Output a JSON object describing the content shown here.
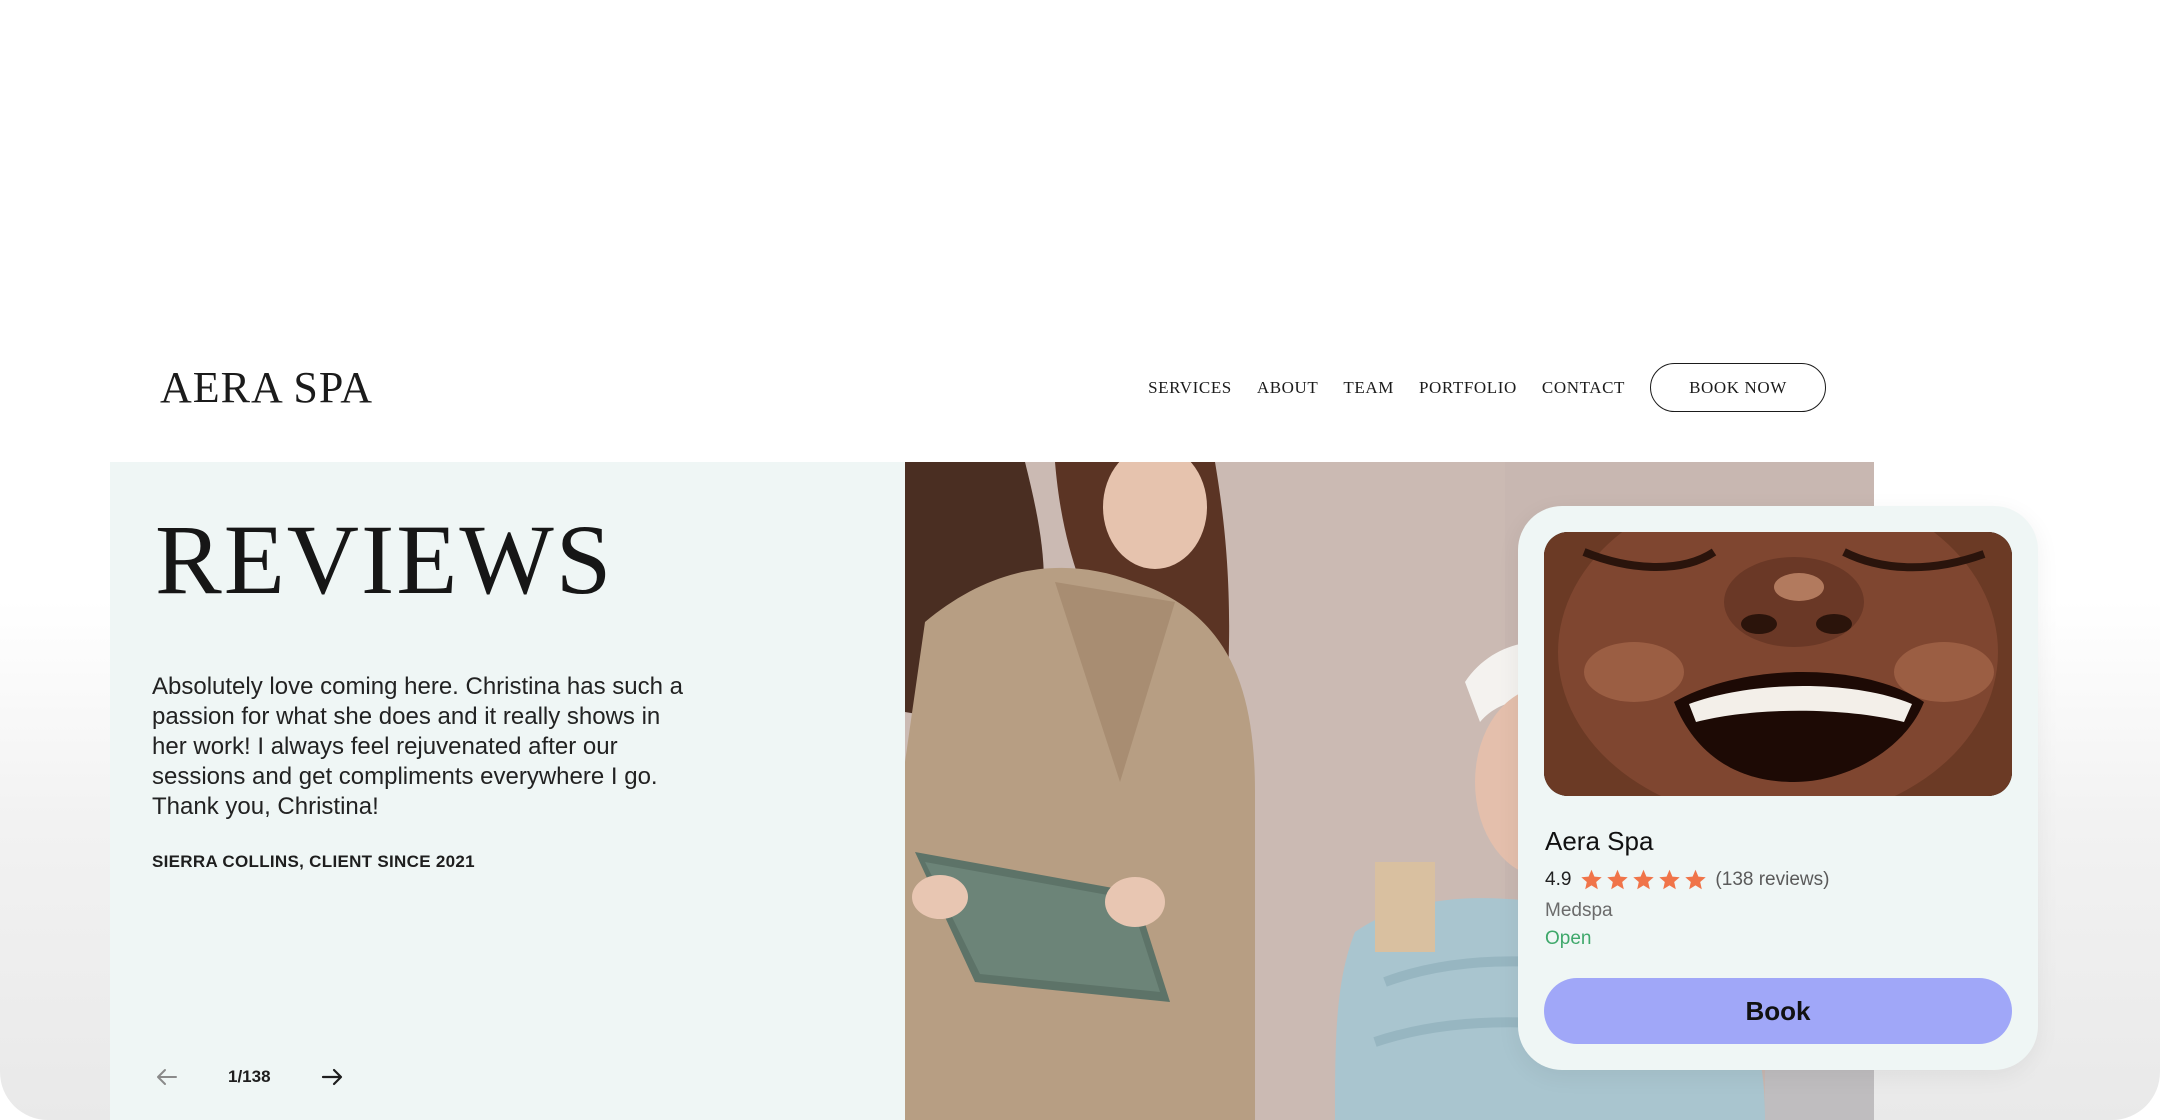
{
  "brand": {
    "logo": "AERA SPA"
  },
  "nav": {
    "items": [
      "SERVICES",
      "ABOUT",
      "TEAM",
      "PORTFOLIO",
      "CONTACT"
    ],
    "cta_label": "BOOK NOW"
  },
  "reviews": {
    "title": "REVIEWS",
    "quote": "Absolutely love coming here. Christina has such a passion for what she does and it really shows in her work! I always feel rejuvenated after our sessions and get compliments everywhere I go. Thank you, Christina!",
    "attribution": "SIERRA COLLINS, CLIENT SINCE 2021",
    "pager": {
      "current": 1,
      "total": 138,
      "label": "1/138"
    }
  },
  "listing_card": {
    "name": "Aera Spa",
    "rating": "4.9",
    "rating_value": 4.9,
    "stars": 5,
    "review_count": "(138 reviews)",
    "category": "Medspa",
    "status": "Open",
    "book_label": "Book",
    "colors": {
      "star": "#f07449",
      "status": "#3fa86b",
      "button": "#a0a7f8"
    }
  },
  "icons": {
    "prev": "arrow-left-icon",
    "next": "arrow-right-icon",
    "star": "star-icon"
  }
}
